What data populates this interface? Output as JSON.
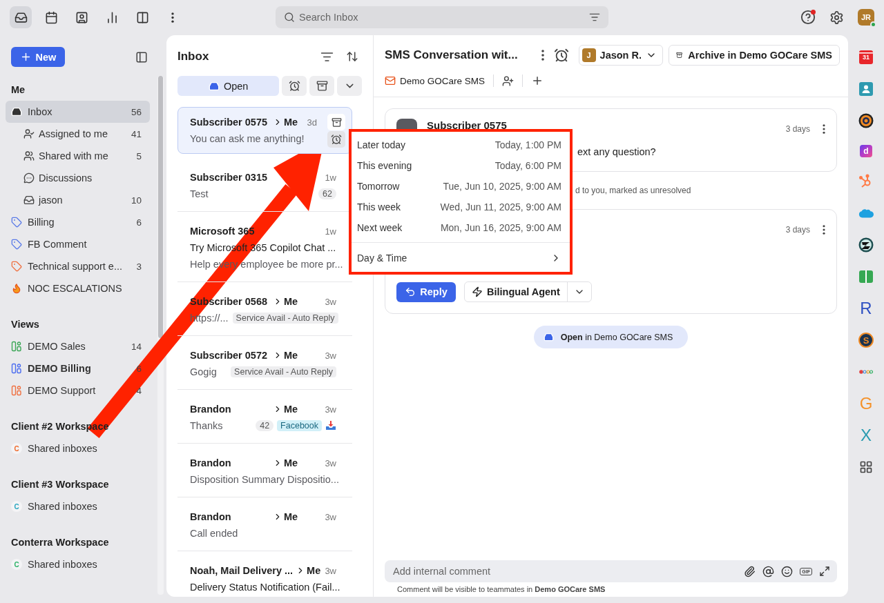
{
  "top_nav": [
    {
      "kind": "inbox",
      "selected": true
    },
    {
      "kind": "calendar",
      "selected": false
    },
    {
      "kind": "contacts",
      "selected": false
    },
    {
      "kind": "analytics",
      "selected": false
    },
    {
      "kind": "split",
      "selected": false
    },
    {
      "kind": "more",
      "selected": false
    }
  ],
  "search": {
    "placeholder": "Search Inbox"
  },
  "help": {
    "notification": true
  },
  "user": {
    "initials": "JR",
    "online": true
  },
  "sidebar": {
    "new_button": "New",
    "sections": [
      {
        "title": "Me",
        "items": [
          {
            "kind": "inbox",
            "label": "Inbox",
            "count": "56",
            "selected": true,
            "children": [
              {
                "kind": "assigned",
                "label": "Assigned to me",
                "count": "41",
                "selected": false
              },
              {
                "kind": "shared",
                "label": "Shared with me",
                "count": "5",
                "selected": false
              },
              {
                "kind": "discussion",
                "label": "Discussions",
                "selected": false
              },
              {
                "kind": "personal",
                "label": "jason",
                "count": "10",
                "selected": false
              }
            ]
          },
          {
            "kind": "tag",
            "label": "Billing",
            "count": "6",
            "color": "#5b7be8",
            "selected": false
          },
          {
            "kind": "tag",
            "label": "FB Comment",
            "color": "#5b7be8",
            "selected": false
          },
          {
            "kind": "tag",
            "label": "Technical support e...",
            "count": "3",
            "color": "#f07040",
            "selected": false
          },
          {
            "kind": "fire",
            "label": "NOC ESCALATIONS",
            "selected": false
          }
        ]
      },
      {
        "title": "Views",
        "items": [
          {
            "kind": "view",
            "label": "DEMO Sales",
            "count": "14",
            "color": "#3aa655",
            "selected": false
          },
          {
            "kind": "view",
            "label": "DEMO Billing",
            "count": "6",
            "color": "#4a6cf0",
            "unread": true,
            "selected": false
          },
          {
            "kind": "view",
            "label": "DEMO Support",
            "count": "4",
            "color": "#f07040",
            "selected": false
          }
        ]
      },
      {
        "title": "Client #2 Workspace",
        "items": [
          {
            "kind": "workspace",
            "badge": "C",
            "label": "Shared inboxes",
            "color": "#f06a2a",
            "selected": false
          }
        ]
      },
      {
        "title": "Client #3 Workspace",
        "items": [
          {
            "kind": "workspace",
            "badge": "C",
            "label": "Shared inboxes",
            "color": "#2aa7c0",
            "selected": false
          }
        ]
      },
      {
        "title": "Conterra Workspace",
        "items": [
          {
            "kind": "workspace",
            "badge": "C",
            "label": "Shared inboxes",
            "color": "#2fb36a",
            "selected": false
          }
        ]
      }
    ]
  },
  "inbox": {
    "title": "Inbox",
    "filters": [
      {
        "kind": "open",
        "label": "Open",
        "selected": true
      },
      {
        "kind": "snoozed",
        "selected": false
      },
      {
        "kind": "archived",
        "selected": false
      },
      {
        "kind": "more",
        "selected": false
      }
    ],
    "conversations": [
      {
        "from": "Subscriber 0575",
        "to": "Me",
        "time": "3d",
        "preview": "You can ask me anything!",
        "selected": true
      },
      {
        "from": "Subscriber 0315",
        "time": "1w",
        "preview": "Test",
        "count": "62",
        "selected": false
      },
      {
        "from": "Microsoft 365",
        "time": "1w",
        "subject": "Try Microsoft 365 Copilot Chat ...",
        "preview": "Help every employee be more pr...",
        "selected": false
      },
      {
        "from": "Subscriber 0568",
        "to": "Me",
        "time": "3w",
        "preview": "https://...",
        "tags": [
          {
            "kind": "label",
            "text": "Service Avail - Auto Reply"
          }
        ],
        "selected": false
      },
      {
        "from": "Subscriber 0572",
        "to": "Me",
        "time": "3w",
        "preview": "Gogig",
        "tags": [
          {
            "kind": "label",
            "text": "Service Avail - Auto Reply"
          }
        ],
        "selected": false
      },
      {
        "from": "Brandon",
        "to": "Me",
        "time": "3w",
        "preview": "Thanks",
        "count": "42",
        "tags": [
          {
            "kind": "channel",
            "text": "Facebook"
          }
        ],
        "channel_icon": true,
        "selected": false
      },
      {
        "from": "Brandon",
        "to": "Me",
        "time": "3w",
        "preview": "Disposition Summary Dispositio...",
        "selected": false
      },
      {
        "from": "Brandon",
        "to": "Me",
        "time": "3w",
        "preview": "Call ended",
        "selected": false
      },
      {
        "from": "Noah, Mail Delivery ...",
        "to": "Me",
        "time": "3w",
        "subject": "Delivery Status Notification (Fail...",
        "selected": false
      }
    ]
  },
  "conversation": {
    "title": "SMS Conversation wit...",
    "assignee": {
      "initial": "J",
      "name": "Jason R."
    },
    "archive_button": "Archive in Demo GOCare SMS",
    "inbox": "Demo GOCare SMS",
    "timeline": [
      {
        "kind": "message",
        "author": "Subscriber 0575",
        "time": "3 days",
        "body": "ext any question?"
      },
      {
        "kind": "event",
        "text": "d to you, marked as unresolved"
      },
      {
        "kind": "message",
        "time": "3 days",
        "reply": "Reply",
        "agent": "Bilingual Agent"
      }
    ],
    "status": "**Open** in Demo GOCare SMS",
    "composer": {
      "placeholder": "Add internal comment",
      "gif_label": "GIF",
      "note": "Comment will be visible to teammates in **Demo GOCare SMS**"
    }
  },
  "snooze_menu": {
    "options": [
      {
        "label": "Later today",
        "time": "Today, 1:00 PM"
      },
      {
        "label": "This evening",
        "time": "Today, 6:00 PM"
      },
      {
        "label": "Tomorrow",
        "time": "Tue, Jun 10, 2025, 9:00 AM"
      },
      {
        "label": "This week",
        "time": "Wed, Jun 11, 2025, 9:00 AM"
      },
      {
        "label": "Next week",
        "time": "Mon, Jun 16, 2025, 9:00 AM"
      }
    ],
    "custom": "Day & Time"
  },
  "apps": [
    {
      "kind": "calendar",
      "text": "31",
      "color": "#e8262b"
    },
    {
      "kind": "contact",
      "color": "#2e9ab0"
    },
    {
      "kind": "ring",
      "color": "#f08a24"
    },
    {
      "kind": "gradient",
      "text": "d",
      "color": "#b43cc8"
    },
    {
      "kind": "sprocket",
      "color": "#ff7a45"
    },
    {
      "kind": "cloud",
      "color": "#1ea1e0"
    },
    {
      "kind": "badge",
      "color": "#1d4e50"
    },
    {
      "kind": "book",
      "color": "#36a853"
    },
    {
      "kind": "letter",
      "text": "R",
      "color": "#2d4fc2"
    },
    {
      "kind": "sphere",
      "text": "S",
      "color": "#f08a24"
    },
    {
      "kind": "dots",
      "color": "#e04040"
    },
    {
      "kind": "letter",
      "text": "G",
      "color": "#f5922a"
    },
    {
      "kind": "letter",
      "text": "X",
      "color": "#2a9bb0"
    },
    {
      "kind": "grid",
      "color": "#444444"
    }
  ]
}
